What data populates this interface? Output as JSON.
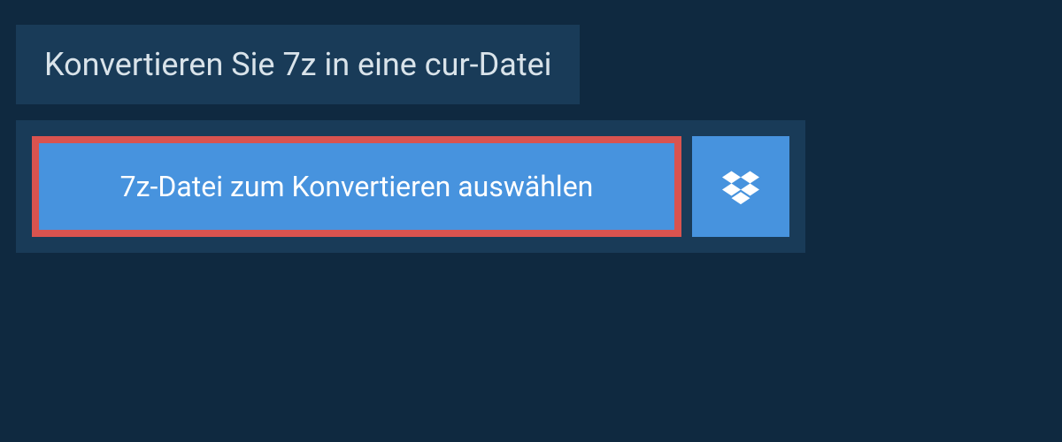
{
  "header": {
    "title": "Konvertieren Sie 7z in eine cur-Datei"
  },
  "actions": {
    "select_file_label": "7z-Datei zum Konvertieren auswählen",
    "dropbox_icon": "dropbox-icon"
  },
  "colors": {
    "page_bg": "#0f2940",
    "panel_bg": "#193b58",
    "button_bg": "#4793de",
    "highlight_border": "#d9534f",
    "text_light": "#d9e3ea",
    "text_white": "#ffffff"
  }
}
